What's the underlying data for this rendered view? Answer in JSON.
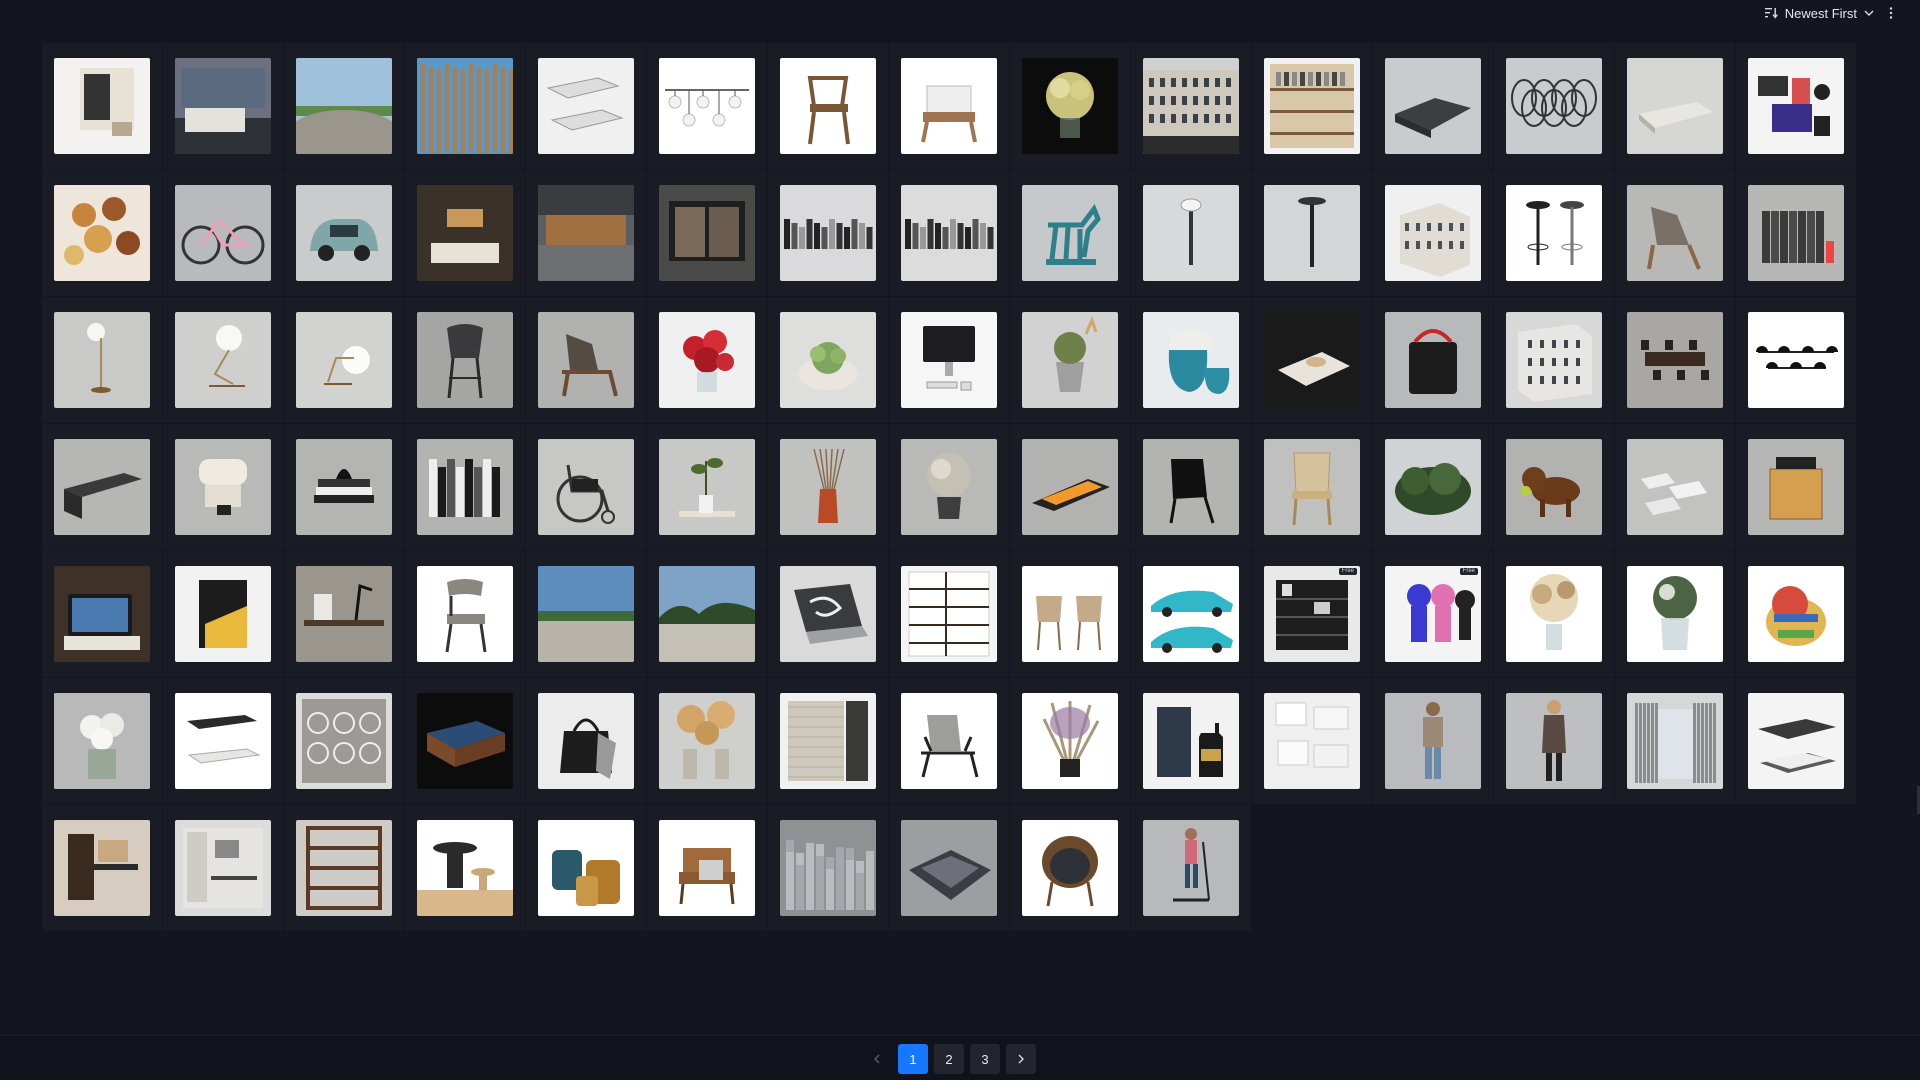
{
  "toolbar": {
    "sort_label": "Newest First",
    "sort_icon": "sort-lines-icon",
    "chevron_icon": "chevron-down-icon",
    "more_icon": "more-vertical-icon"
  },
  "assets": [
    {
      "kind": "coffee-machine",
      "bg": "#f3f2f0"
    },
    {
      "kind": "bedroom-interior",
      "bg": "#6b7080"
    },
    {
      "kind": "landscape-sky",
      "bg": "#a9c2d6"
    },
    {
      "kind": "wooden-slats",
      "bg": "#6a9cc4"
    },
    {
      "kind": "sun-loungers",
      "bg": "#f0f0f0"
    },
    {
      "kind": "pendant-lights",
      "bg": "#ffffff",
      "tag": ""
    },
    {
      "kind": "wooden-chair",
      "bg": "#ffffff"
    },
    {
      "kind": "armchair",
      "bg": "#ffffff"
    },
    {
      "kind": "flower-bouquet",
      "bg": "#0c0c0c"
    },
    {
      "kind": "building-facade",
      "bg": "#d0d0d0"
    },
    {
      "kind": "bookshelf",
      "bg": "#f2f2f2"
    },
    {
      "kind": "sectional-sofa",
      "bg": "#c9cbce"
    },
    {
      "kind": "wire-sculpture",
      "bg": "#c9cbce"
    },
    {
      "kind": "daybed",
      "bg": "#d6d6d4"
    },
    {
      "kind": "desk-gadgets",
      "bg": "#f4f4f4"
    },
    {
      "kind": "donuts",
      "bg": "#eee6da"
    },
    {
      "kind": "bicycle",
      "bg": "#b8babd"
    },
    {
      "kind": "small-car",
      "bg": "#c9cbcd"
    },
    {
      "kind": "hotel-room",
      "bg": "#3c342c"
    },
    {
      "kind": "shop-counter",
      "bg": "#5b5e62"
    },
    {
      "kind": "storefront",
      "bg": "#4a4a48"
    },
    {
      "kind": "books-row",
      "bg": "#dadadc"
    },
    {
      "kind": "books-row",
      "bg": "#dcdcdc"
    },
    {
      "kind": "horse-statue",
      "bg": "#c6c9cc"
    },
    {
      "kind": "street-lamp",
      "bg": "#d8d9db"
    },
    {
      "kind": "floor-lamp",
      "bg": "#d4d5d7"
    },
    {
      "kind": "building-corner",
      "bg": "#f0f0f0"
    },
    {
      "kind": "bar-stools",
      "bg": "#ffffff"
    },
    {
      "kind": "lounge-chair",
      "bg": "#b8b8b6"
    },
    {
      "kind": "book-binders",
      "bg": "#b7b7b5"
    },
    {
      "kind": "floor-lamp-globe",
      "bg": "#c9c9c7"
    },
    {
      "kind": "table-lamp-globe",
      "bg": "#cfcfcd"
    },
    {
      "kind": "table-lamp-small",
      "bg": "#d2d2d0"
    },
    {
      "kind": "bar-chair",
      "bg": "#a5a5a3"
    },
    {
      "kind": "wood-lounge-chair",
      "bg": "#b1b1af"
    },
    {
      "kind": "red-flowers",
      "bg": "#f0f0f0"
    },
    {
      "kind": "succulent-pot",
      "bg": "#dededc"
    },
    {
      "kind": "imac",
      "bg": "#f6f6f6"
    },
    {
      "kind": "plant-pot",
      "bg": "#d2d2d2"
    },
    {
      "kind": "vases",
      "bg": "#e9ecee"
    },
    {
      "kind": "coffee-tray",
      "bg": "#1a1a1a"
    },
    {
      "kind": "speaker",
      "bg": "#b8b9bb"
    },
    {
      "kind": "building-block",
      "bg": "#d8d8d8"
    },
    {
      "kind": "dining-set",
      "bg": "#a9a7a4"
    },
    {
      "kind": "chandelier",
      "bg": "#ffffff"
    },
    {
      "kind": "bench",
      "bg": "#b6b6b4"
    },
    {
      "kind": "espresso",
      "bg": "#b9b9b7"
    },
    {
      "kind": "book-stack",
      "bg": "#b4b4b2"
    },
    {
      "kind": "books-standing",
      "bg": "#b3b3b1"
    },
    {
      "kind": "wheelchair",
      "bg": "#c7c7c5"
    },
    {
      "kind": "tray-plant",
      "bg": "#c8c8c6"
    },
    {
      "kind": "diffuser",
      "bg": "#c1c1bf"
    },
    {
      "kind": "dry-plant",
      "bg": "#b9b9b7"
    },
    {
      "kind": "fireplace",
      "bg": "#b2b2b0"
    },
    {
      "kind": "black-chair",
      "bg": "#b3b3b1"
    },
    {
      "kind": "rattan-chair",
      "bg": "#c0c0be"
    },
    {
      "kind": "shrub",
      "bg": "#cfd3d6"
    },
    {
      "kind": "dog",
      "bg": "#b2b2b0"
    },
    {
      "kind": "papers",
      "bg": "#c2c2c0"
    },
    {
      "kind": "side-table",
      "bg": "#b6b6b4"
    },
    {
      "kind": "tablet-dock",
      "bg": "#3e3128"
    },
    {
      "kind": "wall-light",
      "bg": "#f2f2f2"
    },
    {
      "kind": "desk-scene",
      "bg": "#8f8d88"
    },
    {
      "kind": "dining-chair",
      "bg": "#ffffff"
    },
    {
      "kind": "field-sky",
      "bg": "#5d8bb8"
    },
    {
      "kind": "field-trees",
      "bg": "#7ea0c4"
    },
    {
      "kind": "laptop",
      "bg": "#dadada"
    },
    {
      "kind": "shelving",
      "bg": "#f5f5f5"
    },
    {
      "kind": "two-chairs",
      "bg": "#ffffff"
    },
    {
      "kind": "sports-cars",
      "bg": "#ffffff"
    },
    {
      "kind": "shelf-unit",
      "bg": "#e9e9e9",
      "tag": "Free"
    },
    {
      "kind": "figures",
      "bg": "#f4f4f4",
      "tag": "Free"
    },
    {
      "kind": "dried-bouquet",
      "bg": "#ffffff"
    },
    {
      "kind": "glass-vase-plant",
      "bg": "#ffffff"
    },
    {
      "kind": "toy-dog",
      "bg": "#ffffff"
    },
    {
      "kind": "white-flowers",
      "bg": "#cfcfcf"
    },
    {
      "kind": "chaise-longues",
      "bg": "#ffffff"
    },
    {
      "kind": "rug-pattern",
      "bg": "#dcdcda"
    },
    {
      "kind": "pool-table",
      "bg": "#0c0c0c"
    },
    {
      "kind": "handbag",
      "bg": "#ececec"
    },
    {
      "kind": "dry-flowers-vase",
      "bg": "#cfcfcd"
    },
    {
      "kind": "rug-samples",
      "bg": "#f1f1f1"
    },
    {
      "kind": "modern-armchair",
      "bg": "#ffffff"
    },
    {
      "kind": "tall-bouquet",
      "bg": "#ffffff"
    },
    {
      "kind": "whisky-box",
      "bg": "#f2f2f2"
    },
    {
      "kind": "magazines",
      "bg": "#efefef"
    },
    {
      "kind": "man-figure",
      "bg": "#b9bbbe"
    },
    {
      "kind": "woman-figure",
      "bg": "#bebfc1"
    },
    {
      "kind": "curtains",
      "bg": "#d6d7d8"
    },
    {
      "kind": "beds",
      "bg": "#f4f4f4"
    },
    {
      "kind": "wall-desk",
      "bg": "#d6ccc0"
    },
    {
      "kind": "study-room",
      "bg": "#dcdcdc"
    },
    {
      "kind": "wood-shelf",
      "bg": "#cfcbc6"
    },
    {
      "kind": "bowls-decor",
      "bg": "#ffffff"
    },
    {
      "kind": "glass-jars",
      "bg": "#ffffff"
    },
    {
      "kind": "leather-armchair",
      "bg": "#ffffff"
    },
    {
      "kind": "city-model",
      "bg": "#8f9194"
    },
    {
      "kind": "city-block",
      "bg": "#9c9ea1"
    },
    {
      "kind": "round-chair",
      "bg": "#ffffff"
    },
    {
      "kind": "scooter-person",
      "bg": "#b8b9bb"
    }
  ],
  "pagination": {
    "prev_icon": "chevron-left-icon",
    "next_icon": "chevron-right-icon",
    "pages": [
      "1",
      "2",
      "3"
    ],
    "current": "1"
  }
}
